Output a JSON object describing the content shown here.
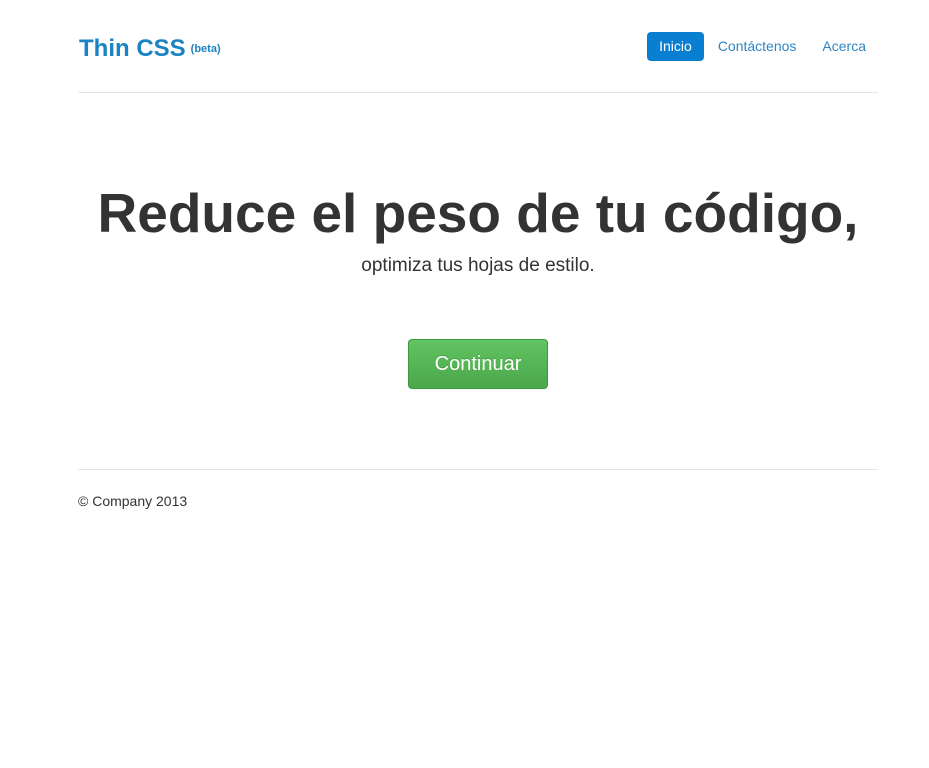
{
  "header": {
    "brand_name": "Thin CSS",
    "brand_tag": "(beta)",
    "nav": [
      {
        "label": "Inicio",
        "active": true
      },
      {
        "label": "Contáctenos",
        "active": false
      },
      {
        "label": "Acerca",
        "active": false
      }
    ]
  },
  "hero": {
    "title": "Reduce el peso de tu código,",
    "subtitle": "optimiza tus hojas de estilo.",
    "button_label": "Continuar"
  },
  "footer": {
    "copyright": "© Company 2013"
  },
  "colors": {
    "brand": "#1a83c3",
    "nav_active_bg": "#0a7fd1",
    "button_green": "#5cb85c"
  }
}
